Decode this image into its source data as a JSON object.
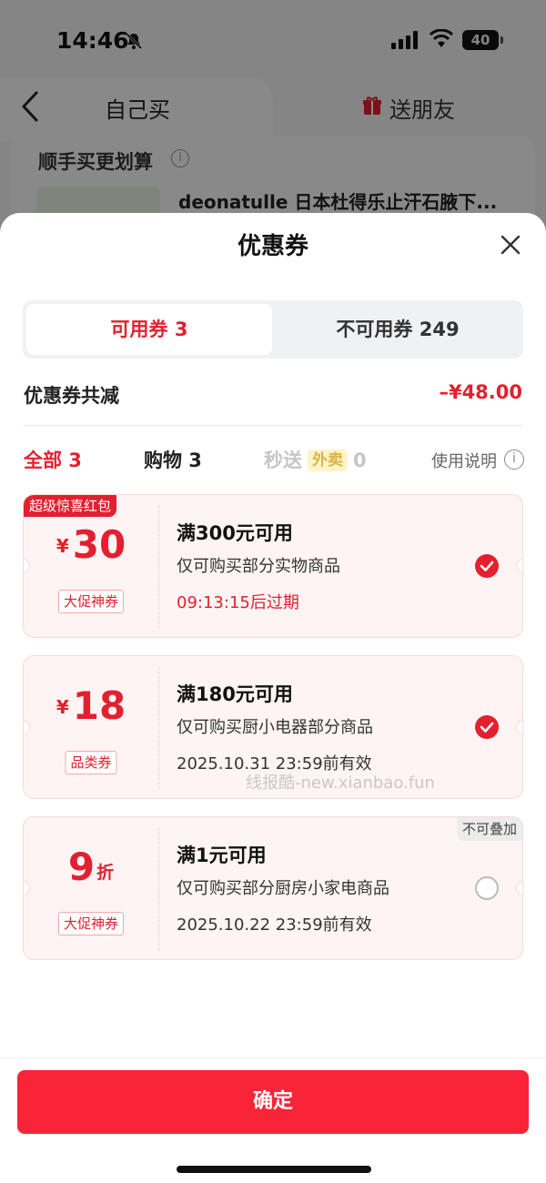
{
  "status_bar": {
    "time": "14:46",
    "battery": "40"
  },
  "bg_page": {
    "tab_self": "自己买",
    "tab_friend": "送朋友",
    "section_title": "顺手买更划算",
    "product_title": "deonatulle 日本杜得乐止汗石腋下..."
  },
  "sheet": {
    "title": "优惠券",
    "segments": {
      "available": "可用券 3",
      "unavailable": "不可用券 249"
    },
    "total": {
      "label": "优惠券共减",
      "value": "–¥48.00"
    },
    "filters": {
      "all": "全部 3",
      "shopping": "购物 3",
      "flash_prefix": "秒送",
      "flash_badge": "外卖",
      "flash_count": "0",
      "help": "使用说明"
    },
    "coupons": [
      {
        "tag": "超级惊喜红包",
        "currency": "¥",
        "amount": "30",
        "type": "大促神券",
        "condition": "满300元可用",
        "scope": "仅可购买部分实物商品",
        "validity": "09:13:15后过期",
        "checked": true
      },
      {
        "currency": "¥",
        "amount": "18",
        "type": "品类券",
        "condition": "满180元可用",
        "scope": "仅可购买厨小电器部分商品",
        "validity": "2025.10.31 23:59前有效",
        "checked": true
      },
      {
        "tag": "不可叠加",
        "amount": "9",
        "unit": "折",
        "type": "大促神券",
        "condition": "满1元可用",
        "scope": "仅可购买部分厨房小家电商品",
        "validity": "2025.10.22 23:59前有效",
        "checked": false
      }
    ],
    "watermark": "线报酷-new.xianbao.fun",
    "confirm": "确定"
  },
  "colors": {
    "accent": "#e3202f",
    "button": "#fa2439",
    "coupon_bg": "#fff4f4"
  }
}
